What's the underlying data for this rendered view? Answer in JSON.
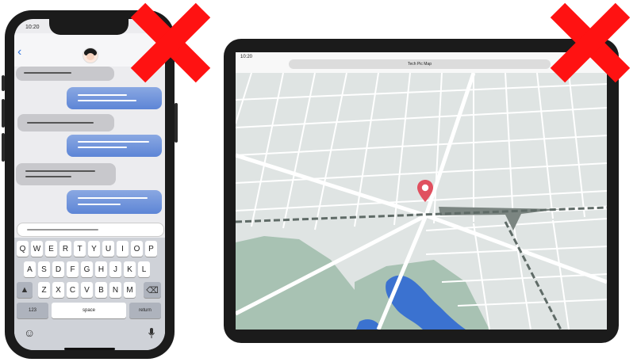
{
  "phone": {
    "status_time": "10:20",
    "back_icon": "chevron-left-icon",
    "keyboard": {
      "row1": [
        "Q",
        "W",
        "E",
        "R",
        "T",
        "Y",
        "U",
        "I",
        "O",
        "P"
      ],
      "row2": [
        "A",
        "S",
        "D",
        "F",
        "G",
        "H",
        "J",
        "K",
        "L"
      ],
      "row3": [
        "Z",
        "X",
        "C",
        "V",
        "B",
        "N",
        "M"
      ],
      "numbers_label": "123",
      "space_label": "space",
      "return_label": "return"
    }
  },
  "tablet": {
    "status_time": "10:20",
    "url_title": "Tech Pic Map"
  },
  "colors": {
    "incoming_bubble": "#c8c8cc",
    "outgoing_bubble": "#5d85d6",
    "map_background": "#dfe4e3",
    "map_road": "#ffffff",
    "park": "#a8c2b3",
    "water": "#3b72d0",
    "railway": "#5f6b67",
    "pin": "#e0505f",
    "cross_mark": "#ff1212"
  }
}
